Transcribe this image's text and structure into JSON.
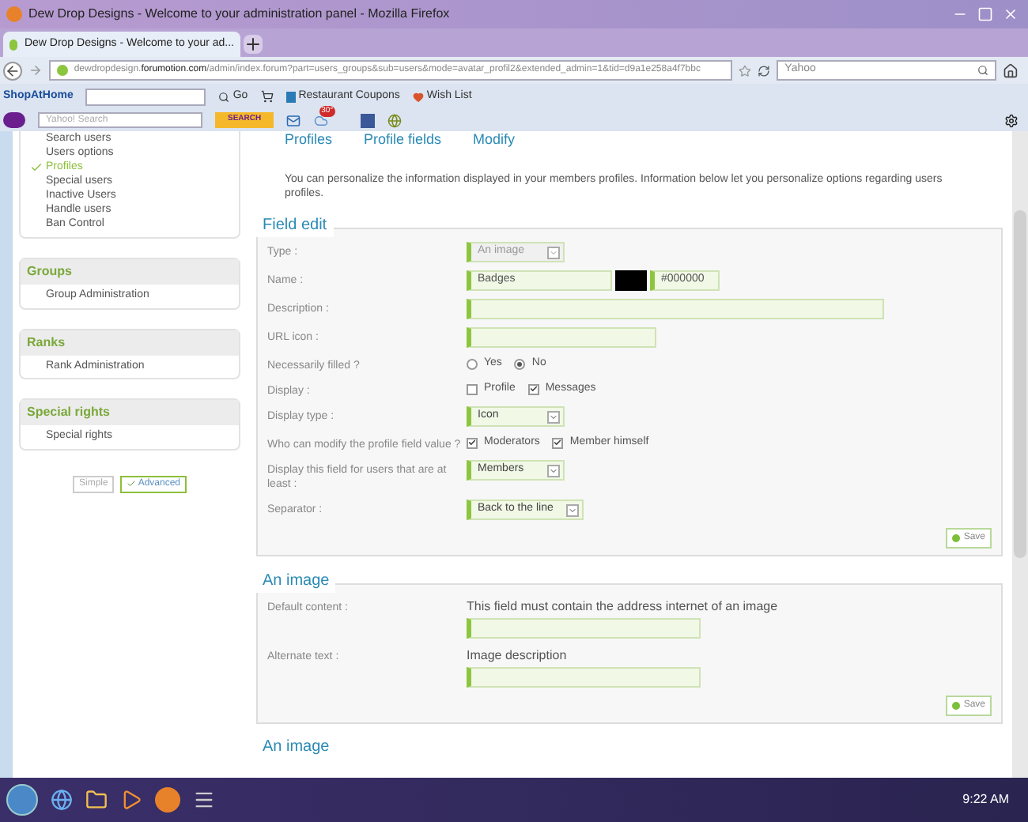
{
  "window": {
    "title": "Dew Drop Designs - Welcome to your administration panel - Mozilla Firefox"
  },
  "tabs": [
    {
      "label": "Dew Drop Designs - Welcome to your ad...",
      "selected": true
    }
  ],
  "address_bar": {
    "host": "dewdropdesign.",
    "domain": "forumotion.com",
    "path": "/admin/index.forum?part=users_groups&sub=users&mode=avatar_profil2&extended_admin=1&tid=d9a1e258a4f7bbc"
  },
  "search_bar": {
    "placeholder": "Yahoo"
  },
  "bookmarks": {
    "brand": "ShopAtHome",
    "go": "Go",
    "items": [
      "Restaurant Coupons",
      "Wish List"
    ]
  },
  "yahoo_toolbar": {
    "placeholder": "Yahoo! Search",
    "button": "SEARCH",
    "badge": "30°"
  },
  "sidebar": {
    "items": [
      {
        "label": "Search users",
        "selected": false
      },
      {
        "label": "Users options",
        "selected": false
      },
      {
        "label": "Profiles",
        "selected": true
      },
      {
        "label": "Special users",
        "selected": false
      },
      {
        "label": "Inactive Users",
        "selected": false
      },
      {
        "label": "Handle users",
        "selected": false
      },
      {
        "label": "Ban Control",
        "selected": false
      }
    ],
    "groups": [
      {
        "title": "Groups",
        "items": [
          "Group Administration"
        ]
      },
      {
        "title": "Ranks",
        "items": [
          "Rank Administration"
        ]
      },
      {
        "title": "Special rights",
        "items": [
          "Special rights"
        ]
      }
    ],
    "modes": [
      {
        "label": "Simple",
        "selected": false
      },
      {
        "label": "Advanced",
        "selected": true
      }
    ]
  },
  "breadcrumb": [
    "Profiles",
    "Profile fields",
    "Modify"
  ],
  "intro": "You can personalize the information displayed in your members profiles. Information below let you personalize options regarding users profiles.",
  "sections": [
    {
      "title": "Field edit",
      "save": "Save",
      "rows": [
        {
          "label": "Type :",
          "kind": "select",
          "value": "An image",
          "disabled": true
        },
        {
          "label": "Name :",
          "kind": "color_text",
          "value": "Badges",
          "color_code": "#000000"
        },
        {
          "label": "Description :",
          "kind": "wide_text"
        },
        {
          "label": "URL icon :",
          "kind": "text"
        },
        {
          "label": "Necessarily filled ?",
          "kind": "radio",
          "options": [
            {
              "label": "Yes",
              "selected": false
            },
            {
              "label": "No",
              "selected": true
            }
          ]
        },
        {
          "label": "Display :",
          "kind": "checkbox",
          "options": [
            {
              "label": "Profile",
              "checked": false
            },
            {
              "label": "Messages",
              "checked": true
            }
          ]
        },
        {
          "label": "Display type :",
          "kind": "select",
          "value": "Icon",
          "disabled": false
        },
        {
          "label": "Who can modify the profile field value ?",
          "kind": "checkbox",
          "options": [
            {
              "label": "Moderators",
              "checked": true
            },
            {
              "label": "Member himself",
              "checked": true
            }
          ]
        },
        {
          "label": "Display this field for users that are at least :",
          "kind": "select",
          "value": "Members",
          "disabled": false
        },
        {
          "label": "Separator :",
          "kind": "select",
          "value": "Back to the line",
          "disabled": false
        }
      ]
    },
    {
      "title": "An image",
      "save": "Save",
      "rows": [
        {
          "label": "Default content :",
          "kind": "hinted_text",
          "hint": "This field must contain the address internet of an image"
        },
        {
          "label": "Alternate text :",
          "kind": "hinted_text",
          "hint": "Image description"
        }
      ]
    }
  ],
  "next_section": {
    "title": "An image"
  },
  "taskbar": {
    "time": "9:22 AM"
  }
}
